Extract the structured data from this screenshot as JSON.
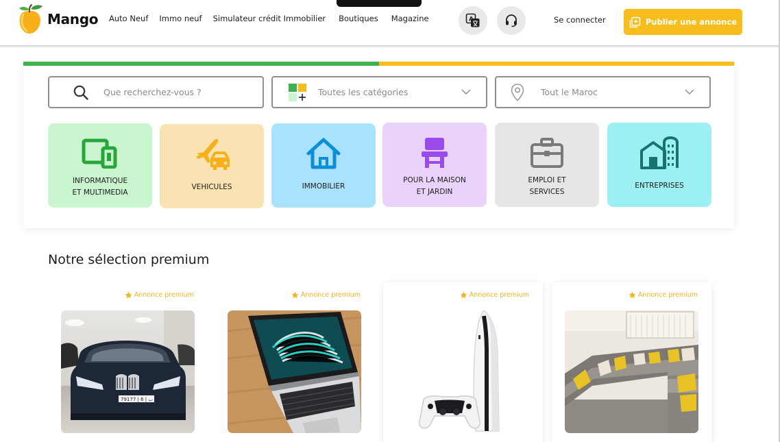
{
  "header": {
    "logo_text": "Mango",
    "nav": [
      "Auto Neuf",
      "Immo neuf",
      "Simulateur crédit Immobilier",
      "Boutiques",
      "Magazine"
    ],
    "translate_icon": "translate-icon",
    "support_icon": "headset-icon",
    "login_label": "Se connecter",
    "publish_label": "Publier une annonce",
    "publish_icon": "add-square-icon"
  },
  "search": {
    "progress_fraction": 0.5,
    "query_placeholder": "Que recherchez-vous ?",
    "category_value": "Toutes les catégories",
    "location_value": "Tout le Maroc"
  },
  "categories": [
    {
      "label": "INFORMATIQUE\nET MULTIMEDIA",
      "icon": "devices-icon",
      "color": "#c9f5cf"
    },
    {
      "label": "VEHICULES",
      "icon": "plane-car-icon",
      "color": "#f9e3b2"
    },
    {
      "label": "IMMOBILIER",
      "icon": "house-icon",
      "color": "#a9e3fb"
    },
    {
      "label": "POUR LA MAISON\nET JARDIN",
      "icon": "chair-icon",
      "color": "#ead3fb"
    },
    {
      "label": "EMPLOI ET\nSERVICES",
      "icon": "briefcase-icon",
      "color": "#e6e6e6"
    },
    {
      "label": "ENTREPRISES",
      "icon": "buildings-icon",
      "color": "#9cf0f2"
    }
  ],
  "premium": {
    "title": "Notre sélection premium",
    "badge_label": "Annonce premium",
    "items": [
      {
        "image": "car-photo"
      },
      {
        "image": "laptop-photo"
      },
      {
        "image": "console-photo"
      },
      {
        "image": "sofa-photo"
      }
    ]
  },
  "colors": {
    "accent_yellow": "#f6bd1d",
    "accent_green": "#3fb24f"
  }
}
